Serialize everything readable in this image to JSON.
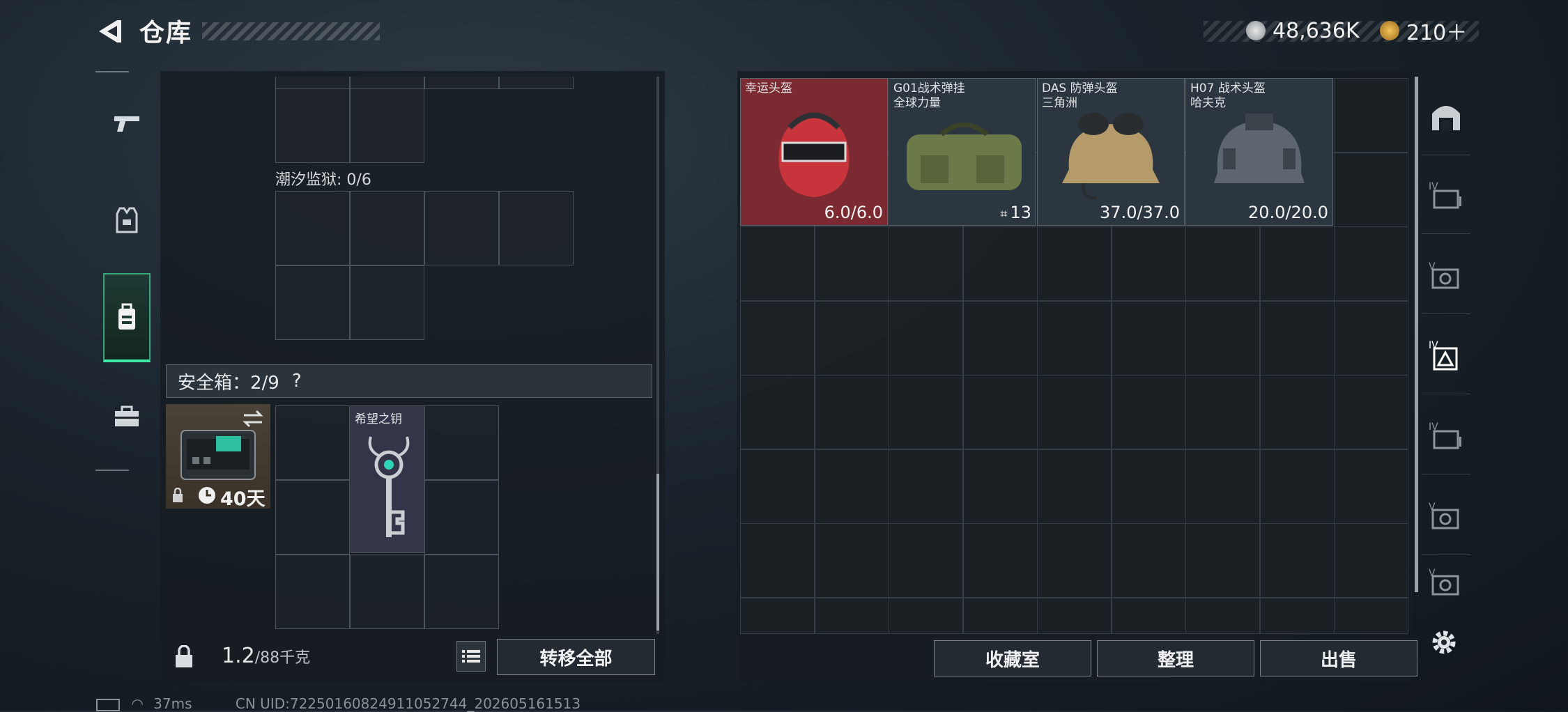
{
  "header": {
    "title": "仓库",
    "currency_silver": "48,636K",
    "currency_gold": "210＋"
  },
  "left": {
    "grid_tide_label": "潮汐监狱: 0/6",
    "safe_box_label": "安全箱：2/9",
    "safe_help": "?",
    "safe_box_timer": "40天",
    "key_item_name": "希望之钥",
    "weight_value": "1.2",
    "weight_unit": "/88千克",
    "transfer_all_label": "转移全部"
  },
  "right": {
    "items": [
      {
        "name": "幸运头盔",
        "value": "6.0/6.0",
        "bg": "#7a2a30"
      },
      {
        "name": "G01战术弹挂\n全球力量",
        "value": "13",
        "bg": "#2c3640"
      },
      {
        "name": "DAS 防弹头盔\n三角洲",
        "value": "37.0/37.0",
        "bg": "#2c3640"
      },
      {
        "name": "H07 战术头盔\n哈夫克",
        "value": "20.0/20.0",
        "bg": "#2c3640"
      }
    ],
    "collection_label": "收藏室",
    "organize_label": "整理",
    "sell_label": "出售"
  },
  "footer": {
    "ping": "37ms",
    "uid": "CN UID:72250160824911052744_202605161513"
  }
}
